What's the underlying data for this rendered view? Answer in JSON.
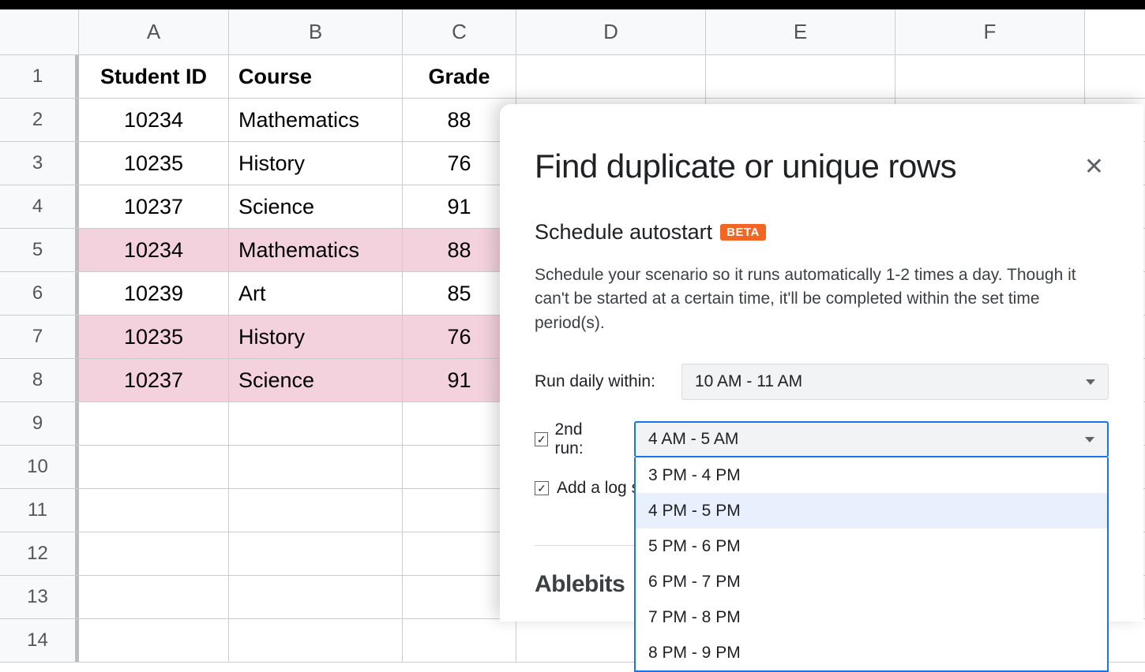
{
  "spreadsheet": {
    "columns": [
      "A",
      "B",
      "C",
      "D",
      "E",
      "F"
    ],
    "row_numbers": [
      "1",
      "2",
      "3",
      "4",
      "5",
      "6",
      "7",
      "8",
      "9",
      "10",
      "11",
      "12",
      "13",
      "14"
    ],
    "header_row": {
      "student_id": "Student ID",
      "course": "Course",
      "grade": "Grade"
    },
    "rows": [
      {
        "student_id": "10234",
        "course": "Mathematics",
        "grade": "88",
        "highlight": false
      },
      {
        "student_id": "10235",
        "course": "History",
        "grade": "76",
        "highlight": false
      },
      {
        "student_id": "10237",
        "course": "Science",
        "grade": "91",
        "highlight": false
      },
      {
        "student_id": "10234",
        "course": "Mathematics",
        "grade": "88",
        "highlight": true
      },
      {
        "student_id": "10239",
        "course": "Art",
        "grade": "85",
        "highlight": false
      },
      {
        "student_id": "10235",
        "course": "History",
        "grade": "76",
        "highlight": true
      },
      {
        "student_id": "10237",
        "course": "Science",
        "grade": "91",
        "highlight": true
      }
    ]
  },
  "panel": {
    "title": "Find duplicate or unique rows",
    "subtitle": "Schedule autostart",
    "beta": "BETA",
    "description": "Schedule your scenario so it runs automatically 1-2 times a day. Though it can't be started at a certain time, it'll be completed within the set time period(s).",
    "run_daily_label": "Run daily within:",
    "run_daily_value": "10 AM - 11 AM",
    "second_run_label": "2nd run:",
    "second_run_value": "4 AM - 5 AM",
    "second_run_options": [
      {
        "label": "3 PM - 4 PM",
        "highlighted": false
      },
      {
        "label": "4 PM - 5 PM",
        "highlighted": true
      },
      {
        "label": "5 PM - 6 PM",
        "highlighted": false
      },
      {
        "label": "6 PM - 7 PM",
        "highlighted": false
      },
      {
        "label": "7 PM - 8 PM",
        "highlighted": false
      },
      {
        "label": "8 PM - 9 PM",
        "highlighted": false
      }
    ],
    "log_label": "Add a log sheet",
    "logo": "Ablebits"
  }
}
